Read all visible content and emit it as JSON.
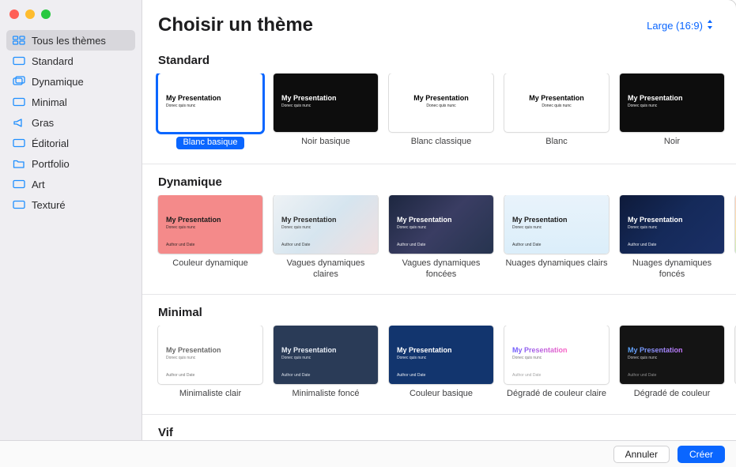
{
  "header": {
    "title": "Choisir un thème",
    "aspect_label": "Large (16:9)"
  },
  "sidebar": {
    "items": [
      {
        "label": "Tous les thèmes",
        "icon": "grid-icon",
        "selected": true
      },
      {
        "label": "Standard",
        "icon": "slide-icon"
      },
      {
        "label": "Dynamique",
        "icon": "layers-icon"
      },
      {
        "label": "Minimal",
        "icon": "slide-icon"
      },
      {
        "label": "Gras",
        "icon": "megaphone-icon"
      },
      {
        "label": "Éditorial",
        "icon": "slide-icon"
      },
      {
        "label": "Portfolio",
        "icon": "folder-icon"
      },
      {
        "label": "Art",
        "icon": "slide-icon"
      },
      {
        "label": "Texturé",
        "icon": "slide-icon"
      }
    ]
  },
  "thumb_text": {
    "title": "My Presentation",
    "subtitle": "Donec quis nunc",
    "author": "Author und Date"
  },
  "sections": [
    {
      "title": "Standard",
      "peek": null,
      "themes": [
        {
          "label": "Blanc basique",
          "selected": true,
          "bg": "#ffffff",
          "fg": "#000000",
          "author": false,
          "align": "left"
        },
        {
          "label": "Noir basique",
          "bg": "#0d0d0d",
          "fg": "#ffffff",
          "author": false,
          "align": "left"
        },
        {
          "label": "Blanc classique",
          "bg": "#ffffff",
          "fg": "#000000",
          "author": false,
          "align": "center"
        },
        {
          "label": "Blanc",
          "bg": "#ffffff",
          "fg": "#000000",
          "author": false,
          "align": "center"
        },
        {
          "label": "Noir",
          "bg": "#0d0d0d",
          "fg": "#ffffff",
          "author": false,
          "align": "left"
        }
      ]
    },
    {
      "title": "Dynamique",
      "peek": "linear-gradient(135deg,#ffd1c2,#ffe7a8,#aef2c9)",
      "themes": [
        {
          "label": "Couleur dynamique",
          "bg": "#f48a8a",
          "fg": "#1b1b1b",
          "author": true,
          "align": "left"
        },
        {
          "label": "Vagues dynamiques claires",
          "bg": "linear-gradient(135deg,#eef2f5,#d6e5ef,#f0dfe0)",
          "fg": "#2b2b2b",
          "author": true,
          "align": "left"
        },
        {
          "label": "Vagues dynamiques foncées",
          "bg": "linear-gradient(135deg,#1d2740,#3a3d63,#26344f)",
          "fg": "#ffffff",
          "author": true,
          "align": "left"
        },
        {
          "label": "Nuages dynamiques clairs",
          "bg": "linear-gradient(180deg,#e9f3fb,#dbeefa)",
          "fg": "#1b1b1b",
          "author": true,
          "align": "left"
        },
        {
          "label": "Nuages dynamiques foncés",
          "bg": "linear-gradient(135deg,#0e1a3a,#152a5a,#1a2f66)",
          "fg": "#ffffff",
          "author": true,
          "align": "left"
        }
      ]
    },
    {
      "title": "Minimal",
      "peek": "#f5f5f5",
      "themes": [
        {
          "label": "Minimaliste clair",
          "bg": "#ffffff",
          "fg": "#6a6a6a",
          "author": true,
          "align": "left"
        },
        {
          "label": "Minimaliste foncé",
          "bg": "#2a3b57",
          "fg": "#e9eef6",
          "author": true,
          "align": "left"
        },
        {
          "label": "Couleur basique",
          "bg": "#12356e",
          "fg": "#ffffff",
          "author": true,
          "align": "left"
        },
        {
          "label": "Dégradé de couleur claire",
          "bg": "#ffffff",
          "fg": "linear-gradient(90deg,#6a5cff,#ff5fc1)",
          "author": true,
          "align": "left"
        },
        {
          "label": "Dégradé de couleur",
          "bg": "#141414",
          "fg": "linear-gradient(90deg,#5aa8ff,#c978ff)",
          "author": true,
          "align": "left"
        }
      ]
    },
    {
      "title": "Vif",
      "stripe": true,
      "themes": [
        {
          "bg": "linear-gradient(90deg,#0e69d1,#1a9be0)"
        },
        {
          "bg": "linear-gradient(90deg,#0b8f8f,#14c9a8)"
        },
        {
          "bg": "linear-gradient(90deg,#d03a3a,#e86b3a)"
        },
        {
          "bg": "linear-gradient(90deg,#7a3ad0,#b93ae0)"
        },
        {
          "bg": "linear-gradient(90deg,#d0a13a,#e0c83a)"
        }
      ]
    }
  ],
  "footer": {
    "cancel": "Annuler",
    "create": "Créer"
  }
}
